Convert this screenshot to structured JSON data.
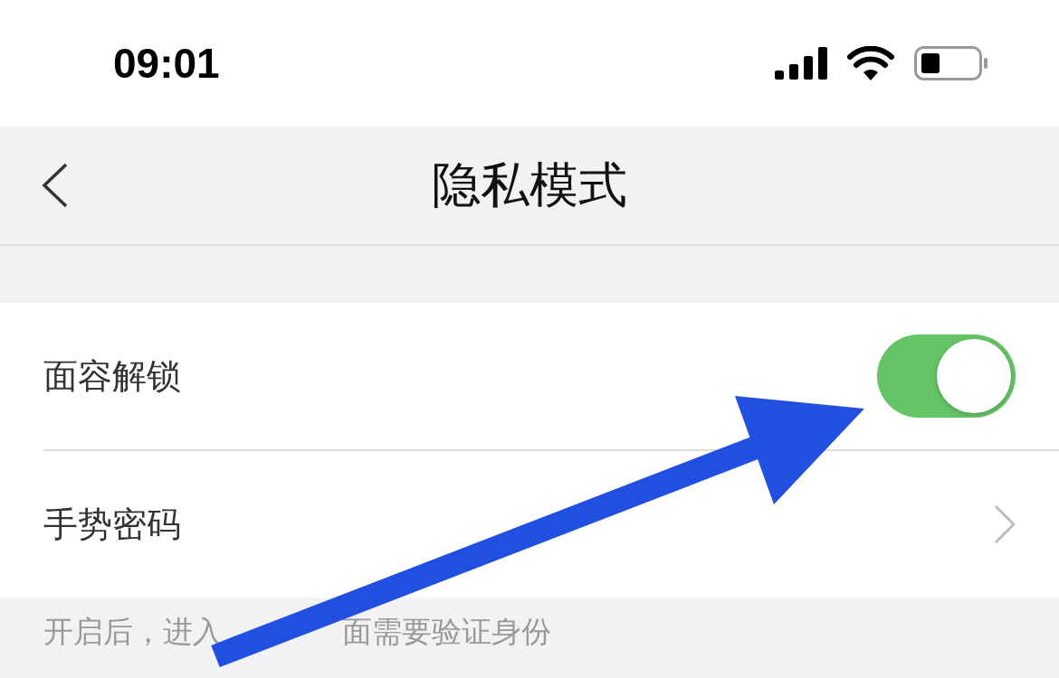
{
  "status_bar": {
    "time": "09:01"
  },
  "nav_bar": {
    "title": "隐私模式"
  },
  "rows": [
    {
      "kind": "toggle",
      "label": "面容解锁",
      "on": true
    },
    {
      "kind": "link",
      "label": "手势密码"
    }
  ],
  "footer_note_parts": [
    "开启后，进入",
    "面需要验证身份"
  ]
}
